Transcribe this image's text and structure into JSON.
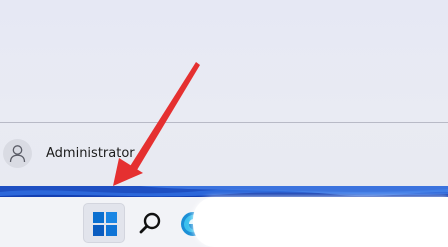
{
  "start_menu": {
    "user": {
      "name": "Administrator",
      "avatar_icon": "person-icon"
    }
  },
  "taskbar": {
    "items": [
      {
        "name": "start",
        "icon": "windows-logo-icon",
        "color": "#0a6fd0"
      },
      {
        "name": "search",
        "icon": "search-icon"
      },
      {
        "name": "edge",
        "icon": "edge-icon",
        "color": "#1c8fd6"
      }
    ]
  },
  "annotation": {
    "arrow_color": "#e53030"
  }
}
